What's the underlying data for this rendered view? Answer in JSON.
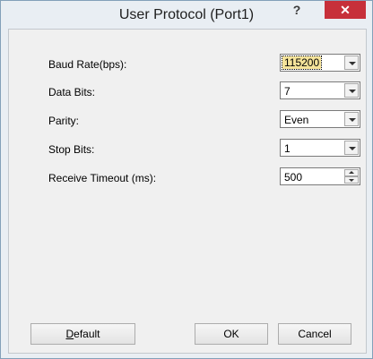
{
  "window": {
    "title": "User Protocol (Port1)",
    "help_label": "?",
    "close_label": "✕"
  },
  "fields": {
    "baud_rate": {
      "label": "Baud Rate(bps):",
      "value": "115200"
    },
    "data_bits": {
      "label": "Data Bits:",
      "value": "7"
    },
    "parity": {
      "label": "Parity:",
      "value": "Even"
    },
    "stop_bits": {
      "label": "Stop Bits:",
      "value": "1"
    },
    "receive_timeout": {
      "label": "Receive Timeout (ms):",
      "value": "500"
    }
  },
  "buttons": {
    "default": "Default",
    "ok": "OK",
    "cancel": "Cancel"
  },
  "colors": {
    "close_button": "#c7303a",
    "selection_highlight": "#f5e39a"
  },
  "icons": [
    "help-icon",
    "close-icon",
    "chevron-down-icon",
    "spin-up-icon",
    "spin-down-icon"
  ]
}
